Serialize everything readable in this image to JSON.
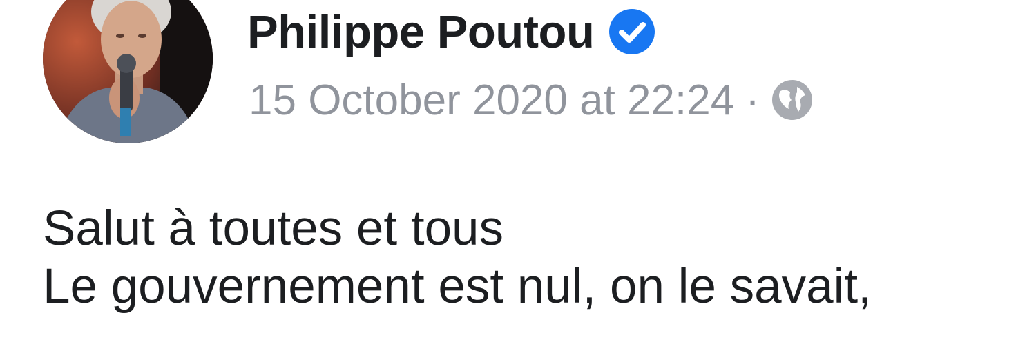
{
  "post": {
    "author": {
      "name": "Philippe Poutou",
      "verified": true
    },
    "timestamp": "15 October 2020 at 22:24",
    "separator": "·",
    "audience_icon": "globe-icon",
    "body_lines": [
      "Salut à toutes et tous",
      "Le gouvernement est nul, on le savait,"
    ]
  },
  "colors": {
    "name_text": "#1c1e21",
    "meta_text": "#90949c",
    "verified_badge": "#1877f2",
    "body_text": "#1c1e21"
  }
}
